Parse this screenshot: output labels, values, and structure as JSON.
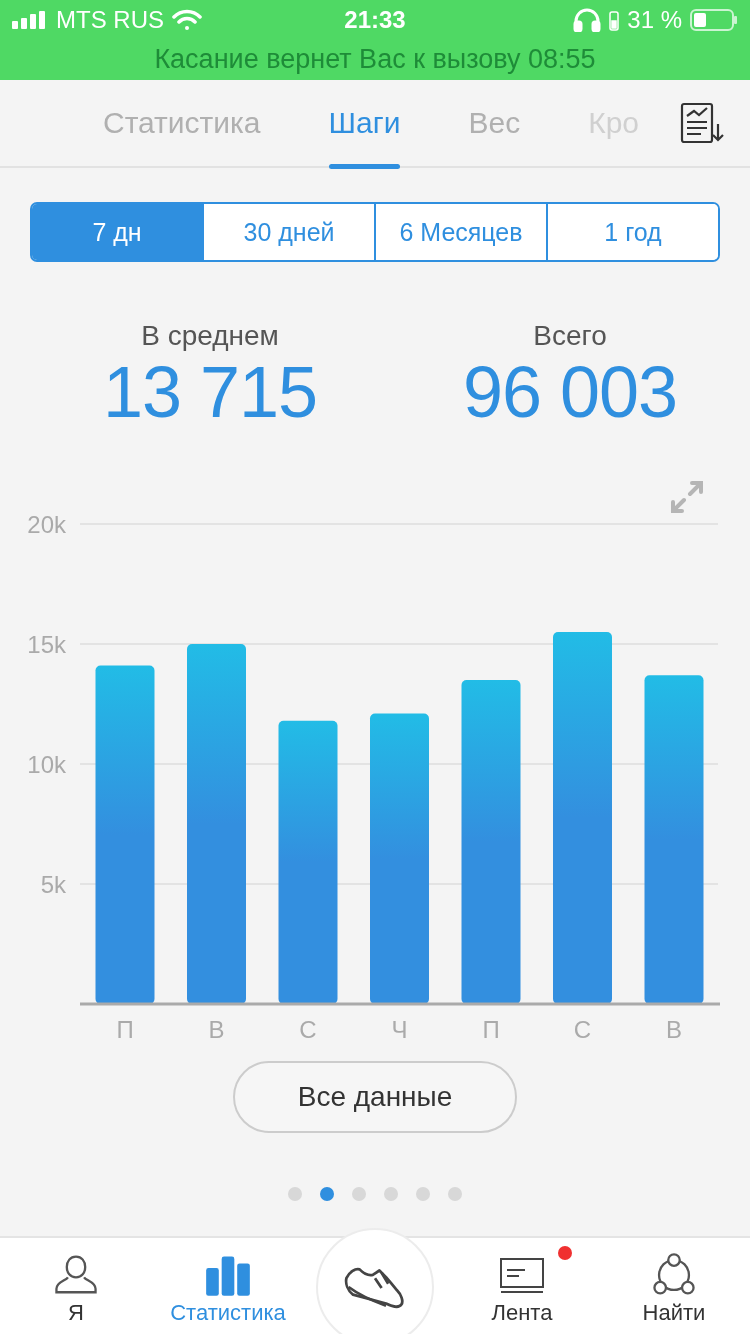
{
  "status_bar": {
    "carrier": "MTS RUS",
    "time": "21:33",
    "battery": "31 %"
  },
  "call_banner": "Касание вернет Вас к вызову 08:55",
  "tabs": [
    {
      "label": "Статистика",
      "selected": false
    },
    {
      "label": "Шаги",
      "selected": true
    },
    {
      "label": "Вес",
      "selected": false
    },
    {
      "label": "Кро",
      "selected": false
    }
  ],
  "periods": [
    {
      "label": "7 дн",
      "selected": true
    },
    {
      "label": "30 дней",
      "selected": false
    },
    {
      "label": "6 Месяцев",
      "selected": false
    },
    {
      "label": "1 год",
      "selected": false
    }
  ],
  "summary": [
    {
      "label": "В среднем",
      "value": "13 715"
    },
    {
      "label": "Всего",
      "value": "96 003"
    }
  ],
  "chart_data": {
    "type": "bar",
    "categories": [
      "П",
      "В",
      "С",
      "Ч",
      "П",
      "С",
      "В"
    ],
    "values": [
      14100,
      15000,
      11800,
      12100,
      13500,
      15500,
      13700
    ],
    "ylim": [
      0,
      20000
    ],
    "grid": true,
    "yticks": [
      {
        "value": 5000,
        "label": "5k"
      },
      {
        "value": 10000,
        "label": "10k"
      },
      {
        "value": 15000,
        "label": "15k"
      },
      {
        "value": 20000,
        "label": "20k"
      }
    ]
  },
  "all_data_button": "Все данные",
  "pages": [
    {
      "selected": false
    },
    {
      "selected": true
    },
    {
      "selected": false
    },
    {
      "selected": false
    },
    {
      "selected": false
    },
    {
      "selected": false
    }
  ],
  "nav": [
    {
      "kind": "person",
      "label": "Я",
      "selected": false,
      "notification": false
    },
    {
      "kind": "bars",
      "label": "Статистика",
      "selected": true,
      "notification": false
    },
    {
      "kind": "shoe",
      "selected": false
    },
    {
      "kind": "feed",
      "label": "Лента",
      "selected": false,
      "notification": true
    },
    {
      "kind": "network",
      "label": "Найти",
      "selected": false,
      "notification": false
    }
  ]
}
